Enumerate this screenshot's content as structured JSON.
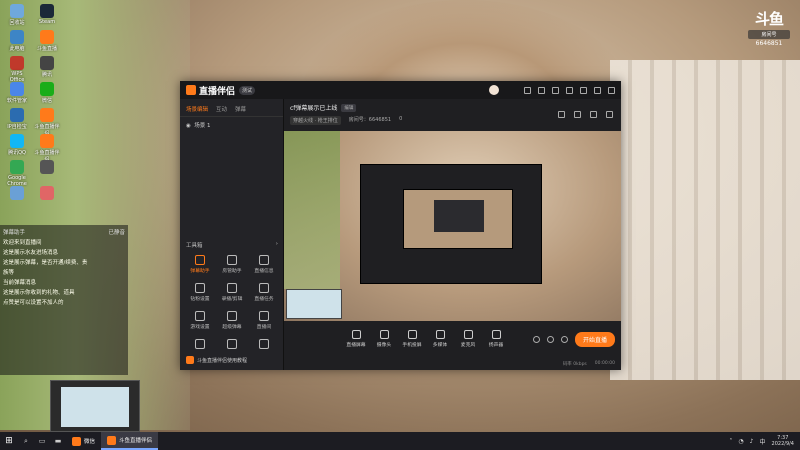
{
  "desktop": {
    "icons": [
      {
        "label": "回收站",
        "color": "#6fa8dc"
      },
      {
        "label": "Steam",
        "color": "#1b2838"
      },
      {
        "label": "此电脑",
        "color": "#3d85c6"
      },
      {
        "label": "斗鱼直播",
        "color": "#ff7a1a"
      },
      {
        "label": "WPS Office",
        "color": "#c0392b"
      },
      {
        "label": "腾讯",
        "color": "#444"
      },
      {
        "label": "软件管家",
        "color": "#4a86e8"
      },
      {
        "label": "微信",
        "color": "#1aad19"
      },
      {
        "label": "IP自检宝",
        "color": "#2b6cb0"
      },
      {
        "label": "斗鱼直播伴侣",
        "color": "#ff7a1a"
      },
      {
        "label": "腾讯QQ",
        "color": "#12b7f5"
      },
      {
        "label": "斗鱼直播伴侣",
        "color": "#ff7a1a"
      },
      {
        "label": "Google Chrome",
        "color": "#34a853"
      },
      {
        "label": "",
        "color": "#555"
      },
      {
        "label": "",
        "color": "#6aa0d6"
      },
      {
        "label": "",
        "color": "#e06666"
      }
    ]
  },
  "logo": {
    "mark": "斗鱼",
    "tag": "房间号",
    "room": "6646851"
  },
  "chat": {
    "header_left": "弹幕助手",
    "header_right": "已静音",
    "lines": [
      "欢迎来到直播间",
      "这是展示水友进场消息",
      "这是展示弹幕，是否开通/续费、贵",
      "族等",
      "当前弹幕消息",
      "这是展示你收到的礼物、道具",
      "点赞是可以设置不加人的"
    ]
  },
  "window": {
    "brand": "直播伴侣",
    "badge": "测试",
    "left_tabs": [
      "场景编辑",
      "互动",
      "弹幕"
    ],
    "scene_item": "场景 1",
    "tools_title": "工具箱",
    "tools": [
      {
        "label": "弹幕助手",
        "active": true
      },
      {
        "label": "房管助手",
        "active": false
      },
      {
        "label": "直播信息",
        "active": false
      },
      {
        "label": "钻粉设置",
        "active": false
      },
      {
        "label": "录播/剪辑",
        "active": false
      },
      {
        "label": "直播任务",
        "active": false
      },
      {
        "label": "游戏设置",
        "active": false
      },
      {
        "label": "超级弹幕",
        "active": false
      },
      {
        "label": "直播间",
        "active": false
      },
      {
        "label": "",
        "active": false
      },
      {
        "label": "",
        "active": false
      },
      {
        "label": "",
        "active": false
      }
    ],
    "record_label": "斗鱼直播伴侣使用教程",
    "stream_title": "cf弹幕展示已上线",
    "stream_tag": "编辑",
    "sub_chip": "穿越火线 · 枪王排位",
    "room_label": "房间号：6646851",
    "viewer_count": "0",
    "controls": [
      "直播屏幕",
      "摄像头",
      "手机投屏",
      "多媒体",
      "麦克风",
      "扬声器"
    ],
    "live_button": "开始直播",
    "status_left": "码率 0kbps",
    "status_right": "00:00:00"
  },
  "taskbar": {
    "apps": [
      {
        "label": "微信",
        "active": false
      },
      {
        "label": "斗鱼直播伴侣",
        "active": true
      }
    ],
    "time": "7:37",
    "date": "2022/9/4"
  }
}
